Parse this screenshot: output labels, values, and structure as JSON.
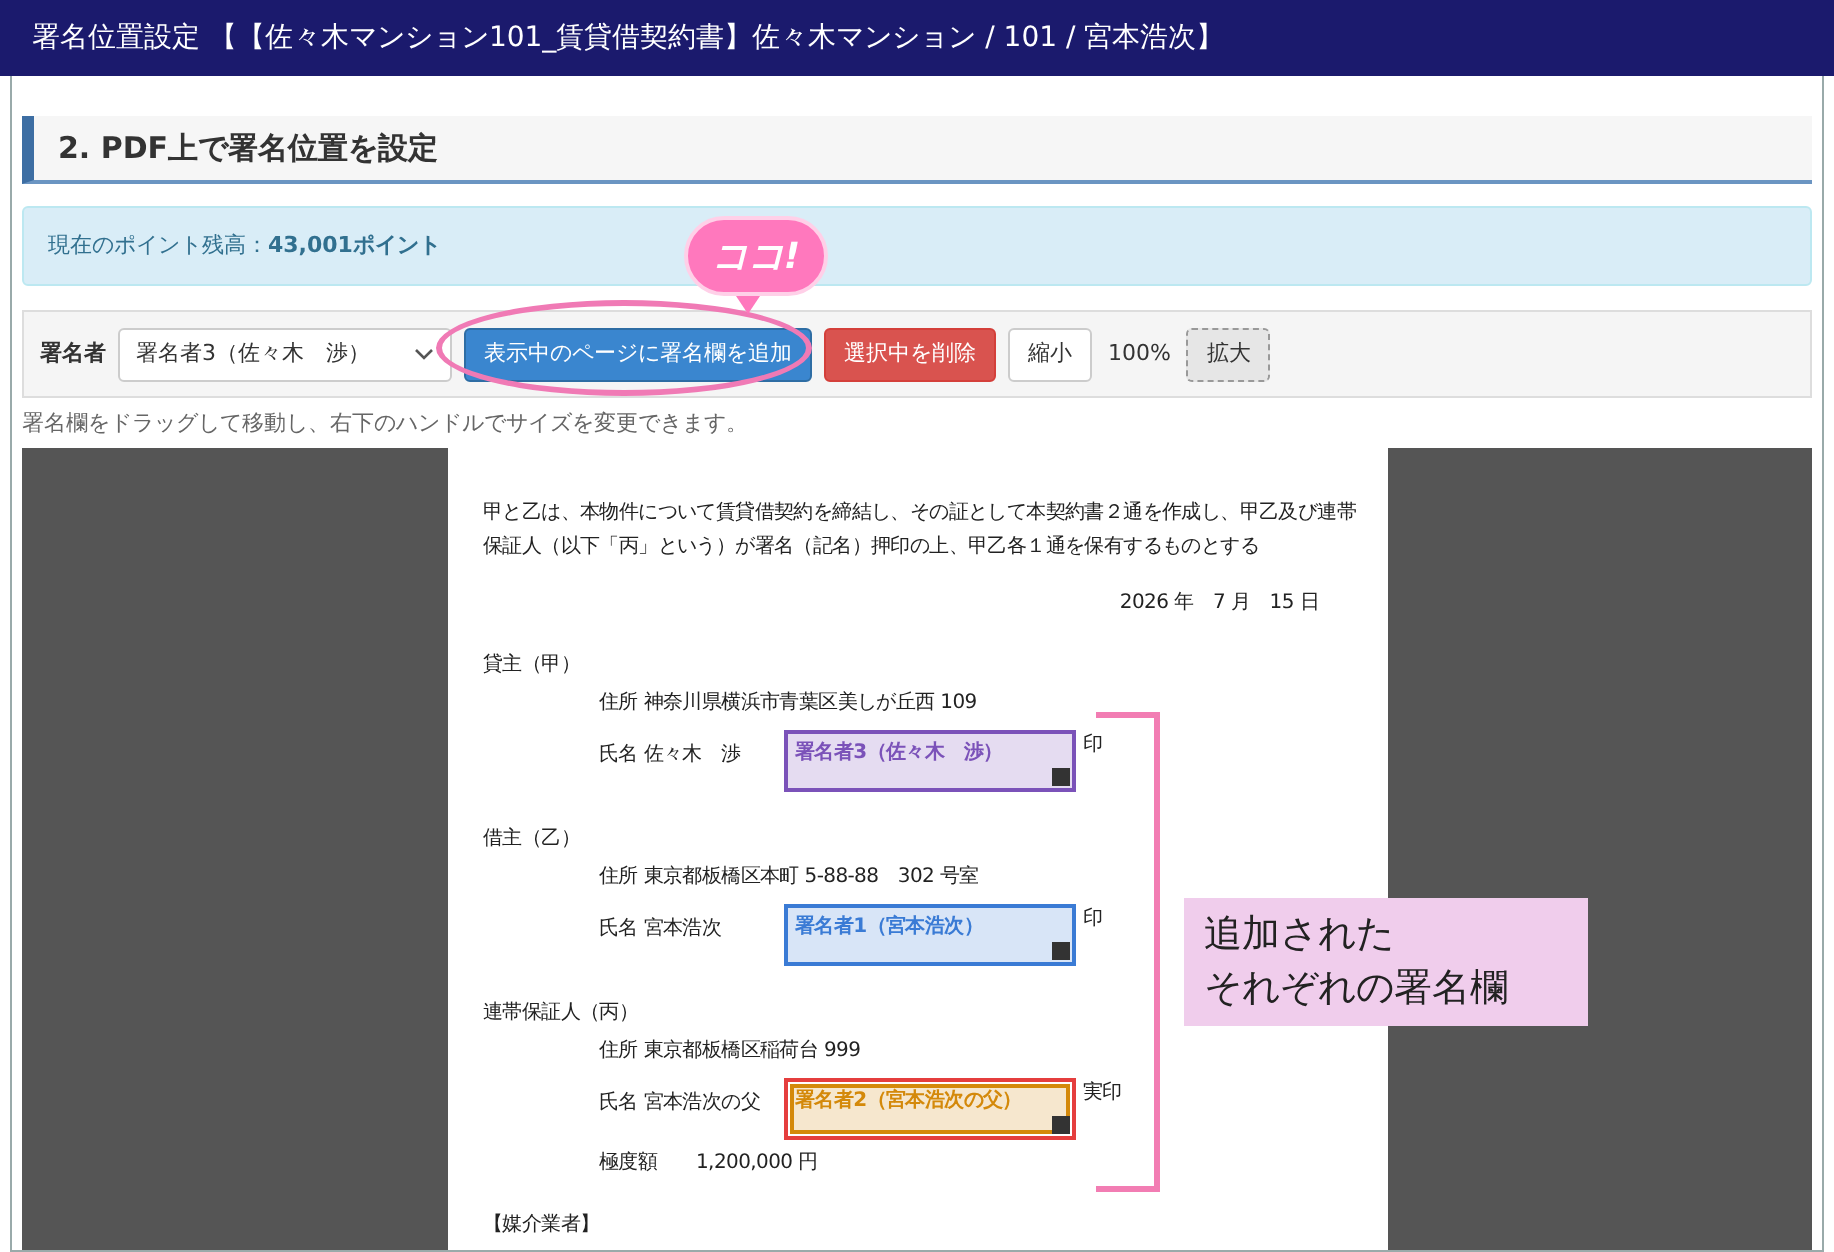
{
  "window": {
    "title": "署名位置設定 【【佐々木マンション101_賃貸借契約書】佐々木マンション / 101 / 宮本浩次】"
  },
  "section": {
    "heading": "2. PDF上で署名位置を設定"
  },
  "points": {
    "text": "現在のポイント残高：**43,001ポイント**"
  },
  "toolbar": {
    "signer_label": "署名者",
    "signer_value": "署名者3（佐々木　渉）",
    "items": [
      {
        "kind": "primary",
        "label": "表示中のページに署名欄を追加"
      },
      {
        "kind": "danger",
        "label": "選択中を削除"
      },
      {
        "kind": "plain",
        "label": "縮小"
      },
      {
        "kind": "readout",
        "label": "100%"
      },
      {
        "kind": "pressed",
        "label": "拡大"
      }
    ]
  },
  "hint": "署名欄をドラッグして移動し、右下のハンドルでサイズを変更できます。",
  "document": {
    "items": [
      {
        "kind": "para",
        "text": "甲と乙は、本物件について賃貸借契約を締結し、その証として本契約書２通を作成し、甲乙及び連帯保証人（以下「丙」という）が署名（記名）押印の上、甲乙各１通を保有するものとする"
      },
      {
        "kind": "date",
        "text": "2026 年　7 月　15 日"
      },
      {
        "kind": "party",
        "text": "貸主（甲）"
      },
      {
        "kind": "address",
        "text": "住所 神奈川県横浜市青葉区美しが丘西 109"
      },
      {
        "kind": "name",
        "text": "氏名 佐々木　渉",
        "seal": "印",
        "field": {
          "label": "署名者3（佐々木　渉）",
          "color": "#7b52b9",
          "selected": false
        }
      },
      {
        "kind": "party",
        "text": "借主（乙）"
      },
      {
        "kind": "address",
        "text": "住所 東京都板橋区本町 5-88-88　302 号室"
      },
      {
        "kind": "name",
        "text": "氏名 宮本浩次",
        "seal": "印",
        "field": {
          "label": "署名者1（宮本浩次）",
          "color": "#3a7bd5",
          "selected": false
        }
      },
      {
        "kind": "party",
        "text": "連帯保証人（丙）"
      },
      {
        "kind": "address",
        "text": "住所 東京都板橋区稲荷台 999"
      },
      {
        "kind": "name",
        "text": "氏名 宮本浩次の父",
        "seal": "実印",
        "field": {
          "label": "署名者2（宮本浩次の父）",
          "color": "#d4890a",
          "selected": true
        }
      },
      {
        "kind": "address",
        "text": "極度額　　1,200,000 円"
      },
      {
        "kind": "party",
        "text": "【媒介業者】"
      }
    ]
  },
  "annotations": {
    "callout": "ココ!",
    "note": [
      "追加された",
      "それぞれの署名欄"
    ]
  }
}
